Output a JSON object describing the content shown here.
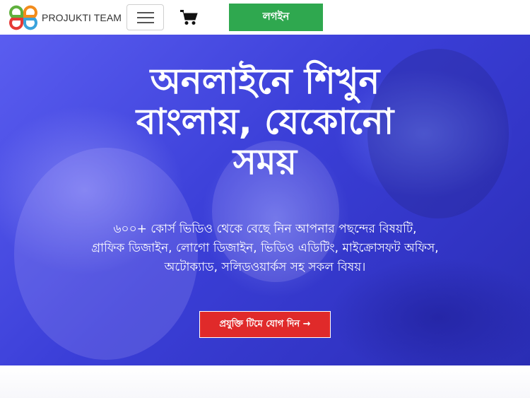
{
  "brand": {
    "name": "PROJUKTI TEAM",
    "logo_icon": "flower-logo-icon"
  },
  "nav": {
    "menu_icon": "hamburger-menu-icon",
    "cart_icon": "shopping-cart-icon",
    "login_label": "লগইন"
  },
  "hero": {
    "title_lines": [
      "অনলাইনে শিখুন",
      "বাংলায়, যেকোনো",
      "সময়"
    ],
    "subtitle_lines": [
      "৬০০+ কোর্স ভিডিও থেকে বেছে নিন আপনার পছন্দের বিষয়টি,",
      "গ্রাফিক ডিজাইন, লোগো ডিজাইন, ভিডিও এডিটিং, মাইক্রোসফট অফিস,",
      "অটোক্যাড, সলিডওয়ার্কস সহ সকল বিষয়।"
    ],
    "cta_label": "প্রযুক্তি টিমে যোগ দিন →"
  },
  "colors": {
    "login_bg": "#2fa84f",
    "cta_bg": "#e02a2a",
    "hero_overlay": "#3b3fd8",
    "logo_green": "#5fb03d",
    "logo_orange": "#f28c1c",
    "logo_blue": "#3aa3dc",
    "logo_red": "#e53935"
  }
}
